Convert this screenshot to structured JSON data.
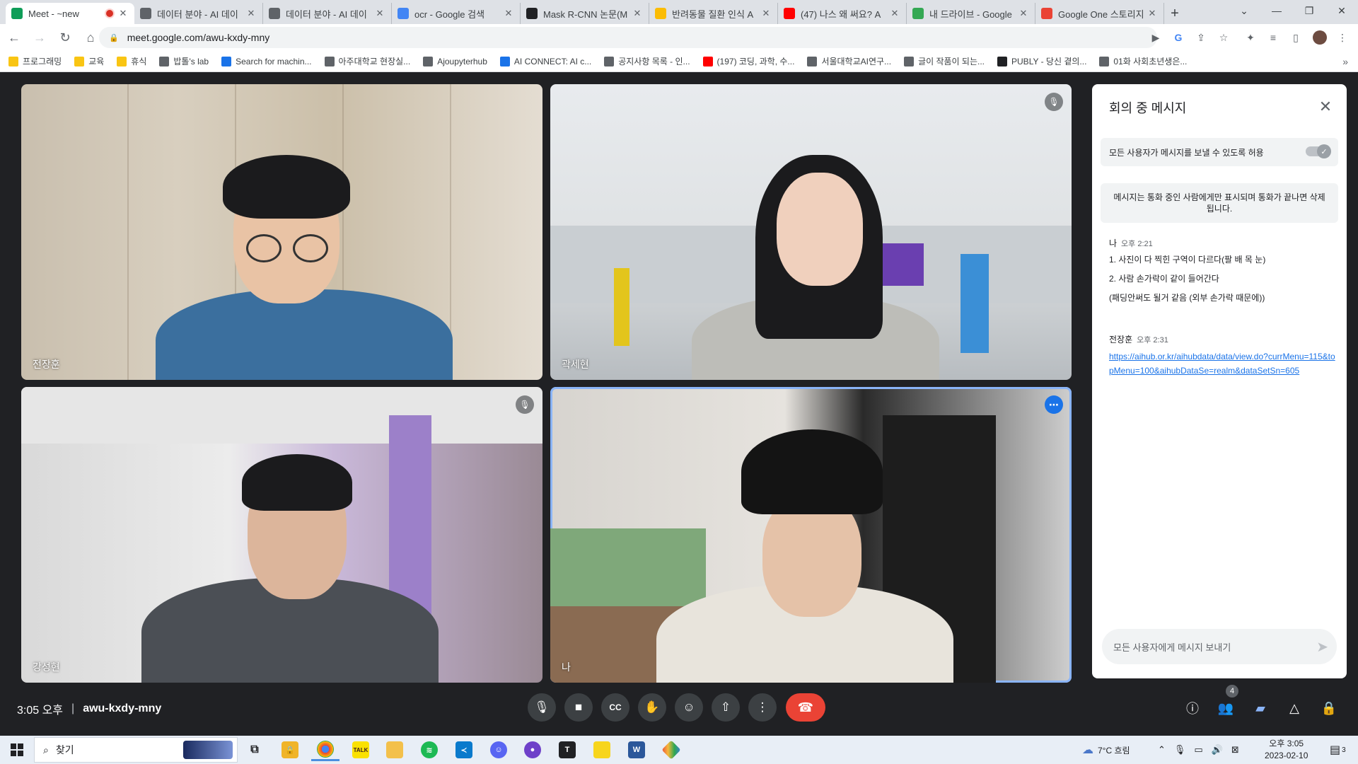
{
  "browser": {
    "tabs": [
      {
        "title": "Meet - ~new",
        "recording": true,
        "active": true,
        "favicon_color": "#0f9d58"
      },
      {
        "title": "데이터 분야 - AI 데이",
        "favicon_color": "#5f6368"
      },
      {
        "title": "데이터 분야 - AI 데이",
        "favicon_color": "#5f6368"
      },
      {
        "title": "ocr - Google 검색",
        "favicon_color": "#4285f4"
      },
      {
        "title": "Mask R-CNN 논문(M",
        "favicon_color": "#202124"
      },
      {
        "title": "반려동물 질환 인식 A",
        "favicon_color": "#fbbc04"
      },
      {
        "title": "(47) 나스 왜 써요? A",
        "favicon_color": "#ff0000"
      },
      {
        "title": "내 드라이브 - Google",
        "favicon_color": "#34a853"
      },
      {
        "title": "Google One 스토리지",
        "favicon_color": "#ea4335"
      }
    ],
    "new_tab_label": "+",
    "url": "meet.google.com/awu-kxdy-mny",
    "bookmarks": [
      {
        "label": "프로그래밍",
        "color": "#f9c513"
      },
      {
        "label": "교육",
        "color": "#f9c513"
      },
      {
        "label": "휴식",
        "color": "#f9c513"
      },
      {
        "label": "밥톨's lab",
        "color": "#5f6368"
      },
      {
        "label": "Search for machin...",
        "color": "#1a73e8"
      },
      {
        "label": "아주대학교 현장실...",
        "color": "#5f6368"
      },
      {
        "label": "Ajoupyterhub",
        "color": "#5f6368"
      },
      {
        "label": "AI CONNECT: AI c...",
        "color": "#1a73e8"
      },
      {
        "label": "공지사항 목록 - 인...",
        "color": "#5f6368"
      },
      {
        "label": "(197) 코딩, 과학, 수...",
        "color": "#ff0000"
      },
      {
        "label": "서울대학교AI연구...",
        "color": "#5f6368"
      },
      {
        "label": "글이 작품이 되는...",
        "color": "#5f6368"
      },
      {
        "label": "PUBLY - 당신 곁의...",
        "color": "#202124"
      },
      {
        "label": "01화 사회초년생은...",
        "color": "#5f6368"
      }
    ],
    "bookmarks_overflow": "»"
  },
  "meet": {
    "participants": [
      {
        "name": "전장훈",
        "muted": false
      },
      {
        "name": "곽세현",
        "muted": true
      },
      {
        "name": "강성현",
        "muted": true
      },
      {
        "name": "나",
        "muted": false
      }
    ],
    "time": "3:05 오후",
    "meeting_code": "awu-kxdy-mny",
    "participant_count": "4"
  },
  "chat": {
    "title": "회의 중 메시지",
    "allow_label": "모든 사용자가 메시지를 보낼 수 있도록 허용",
    "notice": "메시지는 통화 중인 사람에게만 표시되며 통화가 끝나면 삭제됩니다.",
    "messages": [
      {
        "sender": "나",
        "time": "오후 2:21",
        "lines": [
          "1. 사진이 다 찍힌 구역이 다르다(팔 배 목 눈)",
          "2. 사람 손가락이 같이 들어간다",
          "(패딩안써도 될거 같음 (외부 손가락 때문에))"
        ]
      },
      {
        "sender": "전장훈",
        "time": "오후 2:31",
        "link": "https://aihub.or.kr/aihubdata/data/view.do?currMenu=115&topMenu=100&aihubDataSe=realm&dataSetSn=605"
      }
    ],
    "input_placeholder": "모든 사용자에게 메시지 보내기"
  },
  "taskbar": {
    "search_label": "찾기",
    "weather": "7°C 흐림",
    "clock_time": "오후 3:05",
    "clock_date": "2023-02-10",
    "notification_count": "3"
  }
}
